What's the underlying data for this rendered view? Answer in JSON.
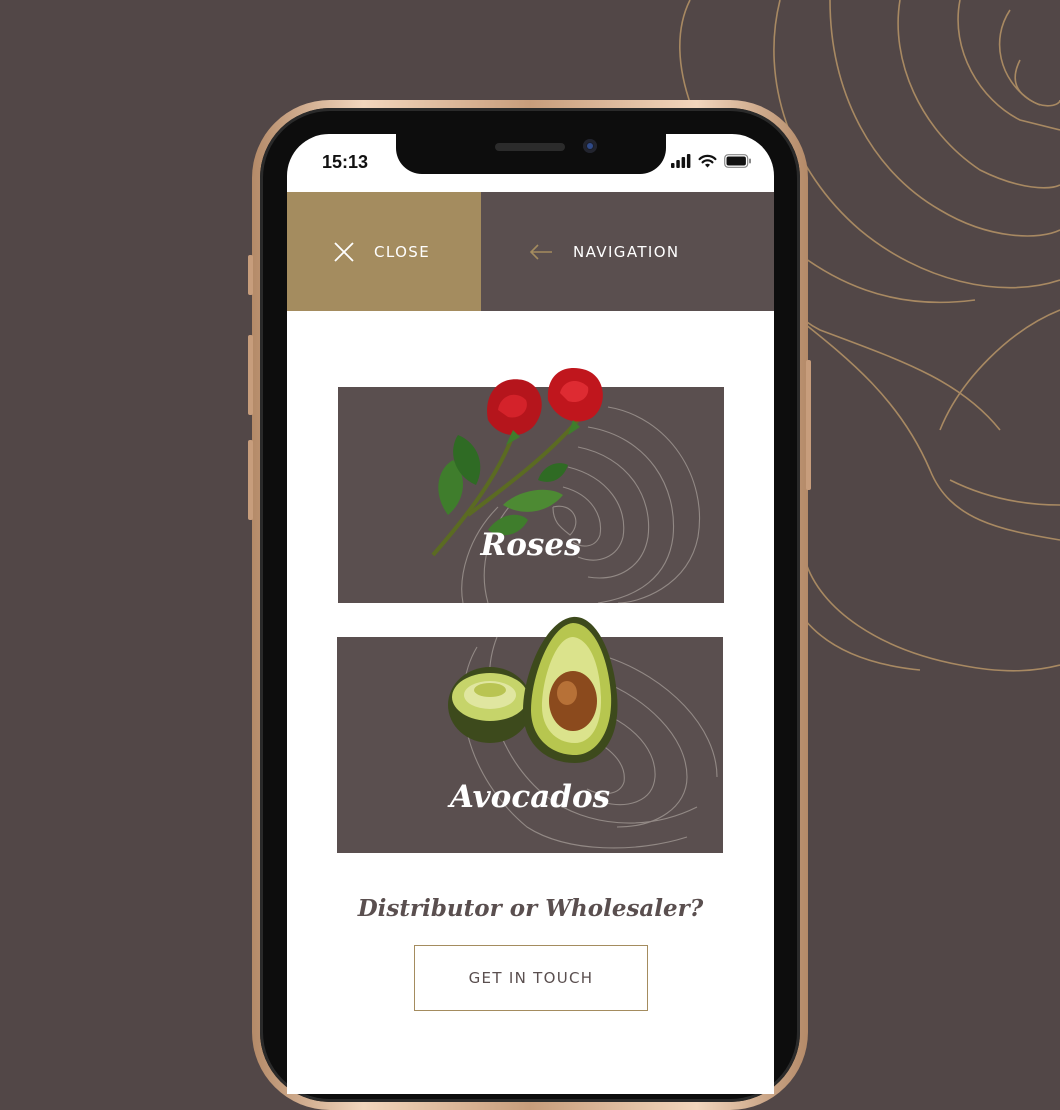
{
  "status_bar": {
    "time": "15:13",
    "icons": [
      "cellular-signal-icon",
      "wifi-icon",
      "battery-icon"
    ]
  },
  "topbar": {
    "close_label": "CLOSE",
    "close_icon": "close-icon",
    "navigation_label": "NAVIGATION",
    "navigation_icon": "arrow-left-icon"
  },
  "cards": [
    {
      "title": "Roses",
      "image": "red-roses"
    },
    {
      "title": "Avocados",
      "image": "avocado-halves"
    }
  ],
  "cta": {
    "question": "Distributor or Wholesaler?",
    "button_label": "GET IN TOUCH"
  },
  "colors": {
    "background": "#524747",
    "accent_gold": "#a48c5f",
    "card_brown": "#5a4f4f",
    "screen_white": "#ffffff"
  }
}
